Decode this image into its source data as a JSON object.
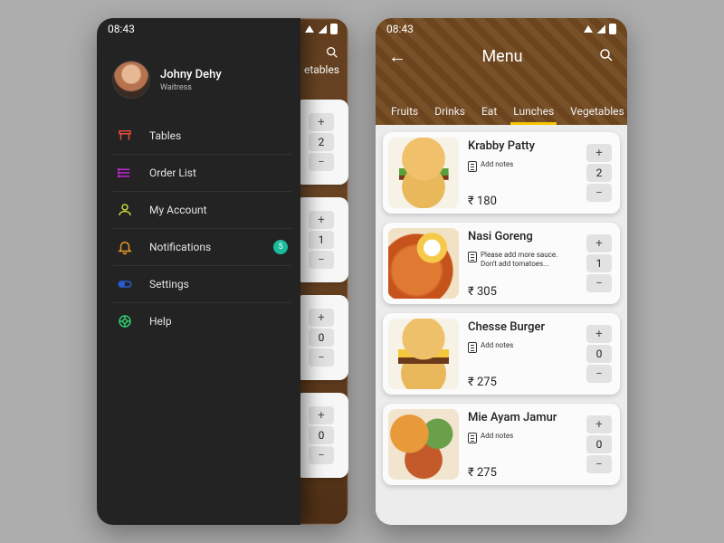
{
  "status": {
    "time": "08:43"
  },
  "drawer": {
    "user_name": "Johny Dehy",
    "user_role": "Waitress",
    "items": [
      {
        "label": "Tables",
        "icon": "table",
        "badge": null
      },
      {
        "label": "Order List",
        "icon": "list",
        "badge": null
      },
      {
        "label": "My Account",
        "icon": "user",
        "badge": null
      },
      {
        "label": "Notifications",
        "icon": "bell",
        "badge": "5"
      },
      {
        "label": "Settings",
        "icon": "toggle",
        "badge": null
      },
      {
        "label": "Help",
        "icon": "lifebuoy",
        "badge": null
      }
    ]
  },
  "peek": {
    "tab_label": "etables",
    "counts": [
      "2",
      "1",
      "0",
      "0"
    ]
  },
  "menu": {
    "title": "Menu",
    "tabs": [
      "Fruits",
      "Drinks",
      "Eat",
      "Lunches",
      "Vegetables"
    ],
    "active_tab": 3,
    "currency": "₹",
    "add_notes_placeholder": "Add notes",
    "items": [
      {
        "name": "Krabby Patty",
        "note": "Add notes",
        "price": "180",
        "qty": "2",
        "thumb": "burger"
      },
      {
        "name": "Nasi Goreng",
        "note": "Please add more sauce. Don't add tomatoes...",
        "price": "305",
        "qty": "1",
        "thumb": "nasi"
      },
      {
        "name": "Chesse Burger",
        "note": "Add notes",
        "price": "275",
        "qty": "0",
        "thumb": "cheese"
      },
      {
        "name": "Mie Ayam Jamur",
        "note": "Add notes",
        "price": "275",
        "qty": "0",
        "thumb": "mie"
      }
    ]
  }
}
